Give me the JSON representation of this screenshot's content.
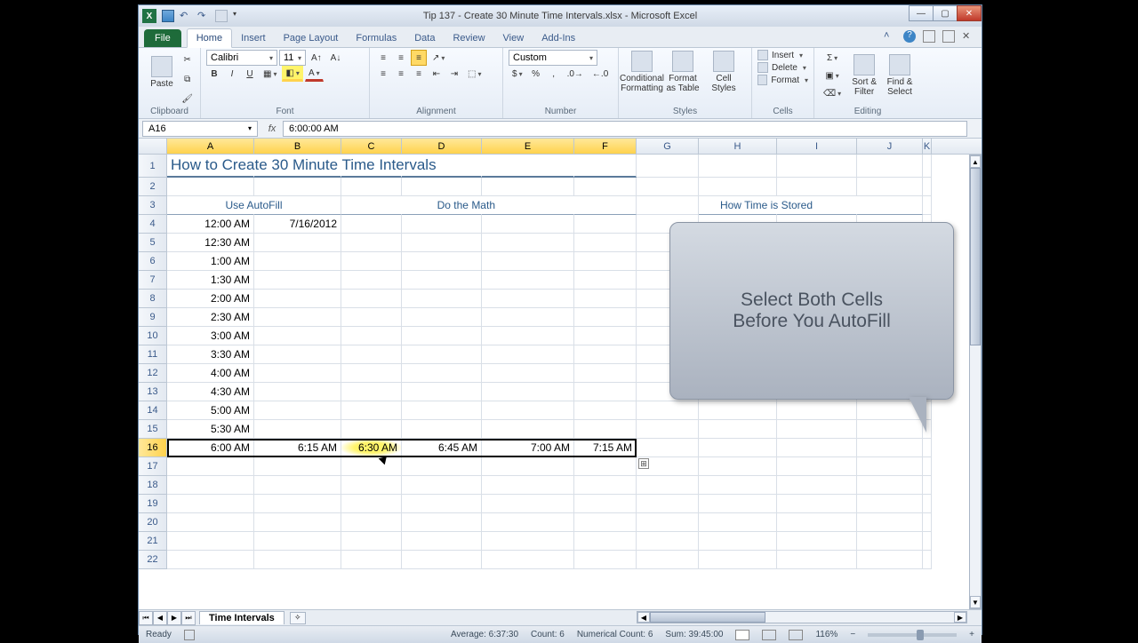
{
  "app": {
    "title": "Tip 137 - Create 30 Minute Time Intervals.xlsx - Microsoft Excel"
  },
  "tabs": {
    "file": "File",
    "items": [
      "Home",
      "Insert",
      "Page Layout",
      "Formulas",
      "Data",
      "Review",
      "View",
      "Add-Ins"
    ],
    "active": "Home"
  },
  "ribbon": {
    "clipboard": {
      "paste": "Paste",
      "label": "Clipboard"
    },
    "font": {
      "name": "Calibri",
      "size": "11",
      "label": "Font"
    },
    "alignment": {
      "label": "Alignment"
    },
    "number": {
      "format": "Custom",
      "label": "Number"
    },
    "styles": {
      "cond": "Conditional\nFormatting",
      "fmt": "Format\nas Table",
      "cell": "Cell\nStyles",
      "label": "Styles"
    },
    "cells": {
      "insert": "Insert",
      "delete": "Delete",
      "format": "Format",
      "label": "Cells"
    },
    "editing": {
      "sort": "Sort &\nFilter",
      "find": "Find &\nSelect",
      "label": "Editing"
    }
  },
  "namebox": "A16",
  "formula": "6:00:00 AM",
  "columns": [
    "A",
    "B",
    "C",
    "D",
    "E",
    "F",
    "G",
    "H",
    "I",
    "J",
    "K"
  ],
  "selectedCols": [
    "A",
    "B",
    "C",
    "D",
    "E",
    "F"
  ],
  "rowCount": 22,
  "selectedRow": 16,
  "sheet": {
    "title": "How to Create 30 Minute Time Intervals",
    "h1": "Use AutoFill",
    "h2": "Do the Math",
    "h3": "How Time is Stored",
    "a": [
      "12:00 AM",
      "12:30 AM",
      "1:00 AM",
      "1:30 AM",
      "2:00 AM",
      "2:30 AM",
      "3:00 AM",
      "3:30 AM",
      "4:00 AM",
      "4:30 AM",
      "5:00 AM",
      "5:30 AM",
      "6:00 AM"
    ],
    "b4": "7/16/2012",
    "row16": [
      "6:00 AM",
      "6:15 AM",
      "6:30 AM",
      "6:45 AM",
      "7:00 AM",
      "7:15 AM"
    ]
  },
  "callout": {
    "line1": "Select Both Cells",
    "line2": "Before You AutoFill"
  },
  "sheetTab": "Time Intervals",
  "status": {
    "ready": "Ready",
    "avg": "Average: 6:37:30",
    "count": "Count: 6",
    "ncount": "Numerical Count: 6",
    "sum": "Sum: 39:45:00",
    "zoom": "116%"
  }
}
